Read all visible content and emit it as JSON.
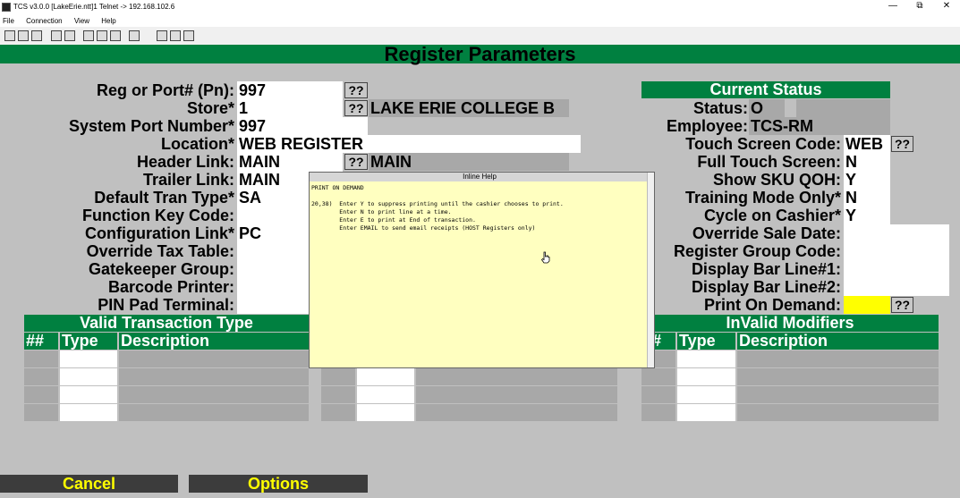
{
  "window": {
    "title": "TCS v3.0.0 [LakeErie.ntt]1 Telnet -> 192.168.102.6",
    "controls": [
      "—",
      "⧉",
      "✕"
    ]
  },
  "menu": [
    "File",
    "Connection",
    "View",
    "Help"
  ],
  "screen_title": "Register Parameters",
  "left_fields": [
    {
      "label": "Reg or Port# (Pn):",
      "value": "997",
      "lookup": "??"
    },
    {
      "label": "Store*",
      "value": "1",
      "lookup": "??",
      "desc": "LAKE ERIE COLLEGE B"
    },
    {
      "label": "System Port Number*",
      "value": "997"
    },
    {
      "label": "Location*",
      "value": "WEB REGISTER"
    },
    {
      "label": "Header Link:",
      "value": "MAIN",
      "lookup": "??",
      "desc": "MAIN"
    },
    {
      "label": "Trailer Link:",
      "value": "MAIN"
    },
    {
      "label": "Default Tran Type*",
      "value": "SA"
    },
    {
      "label": "Function Key Code:",
      "value": ""
    },
    {
      "label": "Configuration Link*",
      "value": "PC"
    },
    {
      "label": "Override Tax Table:",
      "value": ""
    },
    {
      "label": "Gatekeeper Group:",
      "value": ""
    },
    {
      "label": "Barcode Printer:",
      "value": ""
    },
    {
      "label": "PIN Pad Terminal:",
      "value": ""
    }
  ],
  "current_status": {
    "header": "Current Status",
    "status_label": "Status:",
    "status_value": "O",
    "employee_label": "Employee:",
    "employee_value": "TCS-RM"
  },
  "right_fields": [
    {
      "label": "Touch Screen Code:",
      "value": "WEB",
      "lookup": "??"
    },
    {
      "label": "Full Touch Screen:",
      "value": "N"
    },
    {
      "label": "Show SKU QOH:",
      "value": "Y"
    },
    {
      "label": "Training Mode Only*",
      "value": "N"
    },
    {
      "label": "Cycle on Cashier*",
      "value": "Y"
    },
    {
      "label": "Override Sale Date:",
      "value": ""
    },
    {
      "label": "Register Group Code:",
      "value": ""
    },
    {
      "label": "Display Bar Line#1:",
      "value": ""
    },
    {
      "label": "Display Bar Line#2:",
      "value": ""
    },
    {
      "label": "Print On Demand:",
      "value": "",
      "lookup": "??"
    }
  ],
  "grids": {
    "valid_tran": {
      "title": "Valid Transaction Type",
      "cols": [
        "##",
        "Type",
        "Description"
      ]
    },
    "invalid_mod": {
      "title": "InValid Modifiers",
      "cols": [
        "#",
        "Type",
        "Description"
      ]
    }
  },
  "help": {
    "title": "Inline Help",
    "heading": "PRINT ON DEMAND",
    "lines": [
      "20,38)  Enter Y to suppress printing until the cashier chooses to print.",
      "        Enter N to print line at a time.",
      "        Enter E to print at End of transaction.",
      "        Enter EMAIL to send email receipts (HOST Registers only)"
    ]
  },
  "buttons": {
    "cancel": "Cancel",
    "options": "Options"
  },
  "colors": {
    "band": "#008040",
    "highlight": "#ffff00",
    "help_bg": "#ffffc0"
  }
}
